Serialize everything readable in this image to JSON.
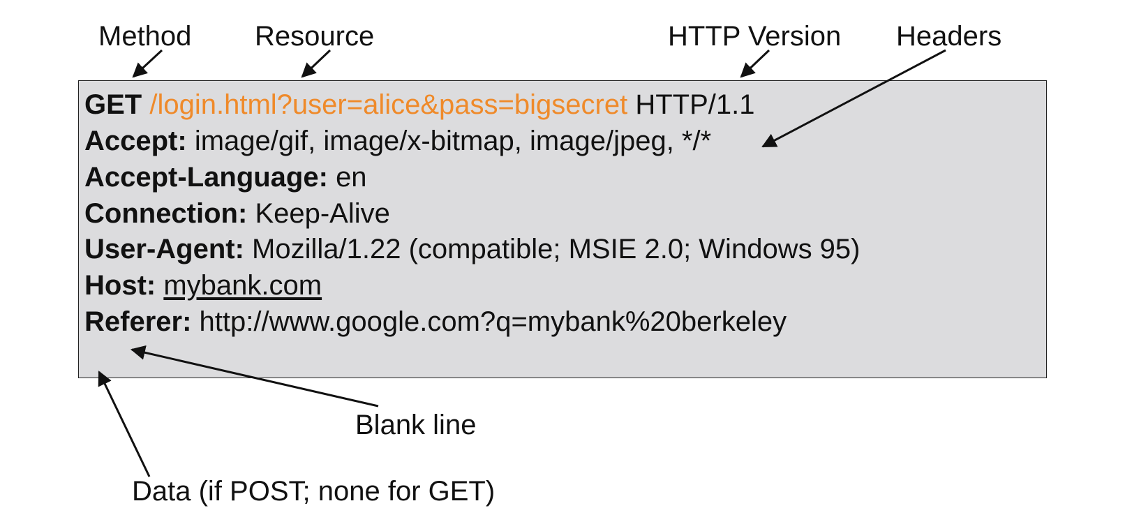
{
  "labels": {
    "method": "Method",
    "resource": "Resource",
    "http_version": "HTTP Version",
    "headers": "Headers",
    "blank_line": "Blank line",
    "data": "Data (if POST; none for GET)"
  },
  "request": {
    "request_line": {
      "method": "GET",
      "resource": "/login.html?user=alice&pass=bigsecret",
      "version": "HTTP/1.1"
    },
    "headers": [
      {
        "key": "Accept:",
        "value": "image/gif, image/x-bitmap, image/jpeg, */*"
      },
      {
        "key": "Accept-Language:",
        "value": "en"
      },
      {
        "key": "Connection:",
        "value": "Keep-Alive"
      },
      {
        "key": "User-Agent:",
        "value": "Mozilla/1.22 (compatible; MSIE 2.0; Windows 95)"
      },
      {
        "key": "Host:",
        "value": "mybank.com"
      },
      {
        "key": "Referer:",
        "value": "http://www.google.com?q=mybank%20berkeley"
      }
    ]
  },
  "colors": {
    "resource_text": "#ef8a2a",
    "box_fill": "#dcdcde",
    "arrow": "#111111"
  }
}
